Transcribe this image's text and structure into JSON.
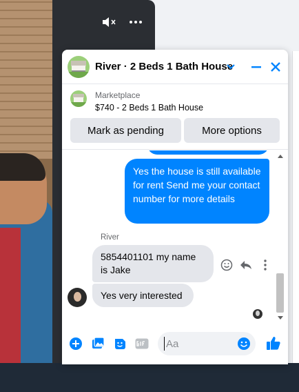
{
  "video": {
    "controls": [
      {
        "name": "mute-icon"
      },
      {
        "name": "more-icon"
      }
    ]
  },
  "chat": {
    "title": "River · 2 Beds 1 Bath House",
    "colors": {
      "accent": "#0084ff",
      "bubble_in": "#e4e6eb",
      "text": "#050505",
      "secondary": "#65676b"
    },
    "marketplace": {
      "label": "Marketplace",
      "listing": "$740 - 2 Beds 1 Bath House",
      "buttons": {
        "pending": "Mark as pending",
        "more": "More options"
      }
    },
    "messages": {
      "outgoing": "Yes the house is still available for rent Send me your contact number for more details",
      "sender": "River",
      "incoming1": "5854401101 my name is Jake",
      "incoming2": "Yes very interested"
    },
    "composer": {
      "placeholder": "Aa"
    }
  }
}
